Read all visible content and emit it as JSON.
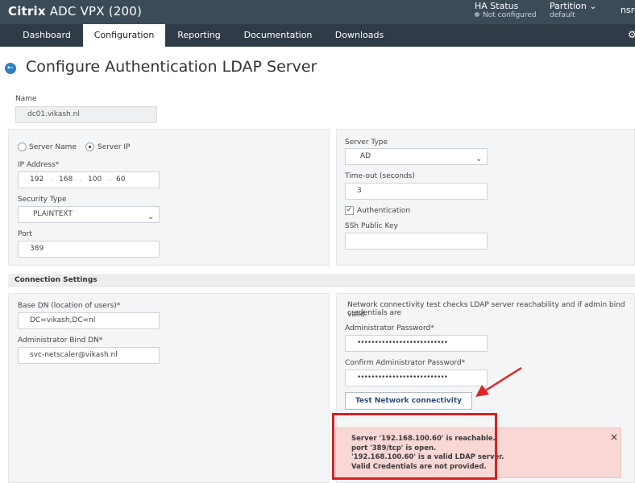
{
  "header": {
    "brand_bold": "Citrix",
    "brand_rest": " ADC VPX (200)",
    "ha_title": "HA Status",
    "ha_status": "Not configured",
    "partition_title": "Partition",
    "partition_value": "default",
    "user": "nsrc"
  },
  "nav": {
    "tabs": [
      "Dashboard",
      "Configuration",
      "Reporting",
      "Documentation",
      "Downloads"
    ],
    "active": "Configuration"
  },
  "page": {
    "title": "Configure Authentication LDAP Server"
  },
  "form": {
    "name_label": "Name",
    "name_value": "dc01.vikash.nl",
    "server_name_label": "Server Name",
    "server_ip_label": "Server IP",
    "ip_label": "IP Address*",
    "ip_octets": [
      "192",
      "168",
      "100",
      "60"
    ],
    "security_label": "Security Type",
    "security_value": "PLAINTEXT",
    "port_label": "Port",
    "port_value": "389",
    "server_type_label": "Server Type",
    "server_type_value": "AD",
    "timeout_label": "Time-out (seconds)",
    "timeout_value": "3",
    "auth_label": "Authentication",
    "ssh_label": "SSh Public Key",
    "ssh_value": ""
  },
  "connection": {
    "section_title": "Connection Settings",
    "base_dn_label": "Base DN (location of users)*",
    "base_dn_value": "DC=vikash,DC=nl",
    "admin_dn_label": "Administrator Bind DN*",
    "admin_dn_value": "svc-netscaler@vikash.nl",
    "info_text_1": "Network connectivity test checks LDAP server reachability and if admin bind credentials are",
    "info_text_2": "valid.",
    "admin_pw_label": "Administrator Password*",
    "admin_pw_value": "••••••••••••••••••••••••••",
    "confirm_pw_label": "Confirm Administrator Password*",
    "confirm_pw_value": "••••••••••••••••••••••••••",
    "test_button": "Test Network connectivity"
  },
  "alert": {
    "line1": "Server '192.168.100.60' is reachable.",
    "line2": "port '389/tcp' is open.",
    "line3": "'192.168.100.60' is a valid LDAP server.",
    "line4": "Valid Credentials are not provided.",
    "close": "×"
  }
}
